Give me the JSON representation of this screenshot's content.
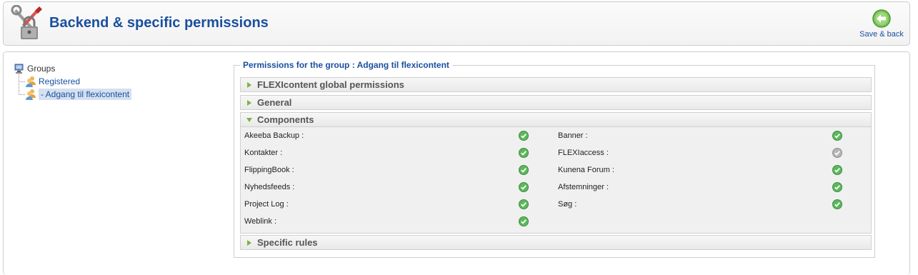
{
  "header": {
    "title": "Backend & specific permissions",
    "save_back_label": "Save & back"
  },
  "tree": {
    "root_label": "Groups",
    "items": [
      {
        "label": "Registered"
      },
      {
        "label": "- Adgang til flexicontent"
      }
    ]
  },
  "permissions": {
    "legend": "Permissions for the group : Adgang til flexicontent",
    "sections": {
      "global": "FLEXIcontent global permissions",
      "general": "General",
      "components": "Components",
      "specific": "Specific rules"
    },
    "components": [
      {
        "label": "Akeeba Backup :",
        "status": "allowed"
      },
      {
        "label": "Banner :",
        "status": "allowed"
      },
      {
        "label": "Kontakter :",
        "status": "allowed"
      },
      {
        "label": "FLEXIaccess :",
        "status": "inactive"
      },
      {
        "label": "FlippingBook :",
        "status": "allowed"
      },
      {
        "label": "Kunena Forum :",
        "status": "allowed"
      },
      {
        "label": "Nyhedsfeeds :",
        "status": "allowed"
      },
      {
        "label": "Afstemninger :",
        "status": "allowed"
      },
      {
        "label": "Project Log :",
        "status": "allowed"
      },
      {
        "label": "Søg :",
        "status": "allowed"
      },
      {
        "label": "Weblink :",
        "status": "allowed"
      }
    ]
  },
  "colors": {
    "title_blue": "#1a4f9e",
    "status_allowed": "#5cb85c",
    "status_inactive": "#b5b5b5",
    "accordion_arrow": "#7cb342"
  }
}
